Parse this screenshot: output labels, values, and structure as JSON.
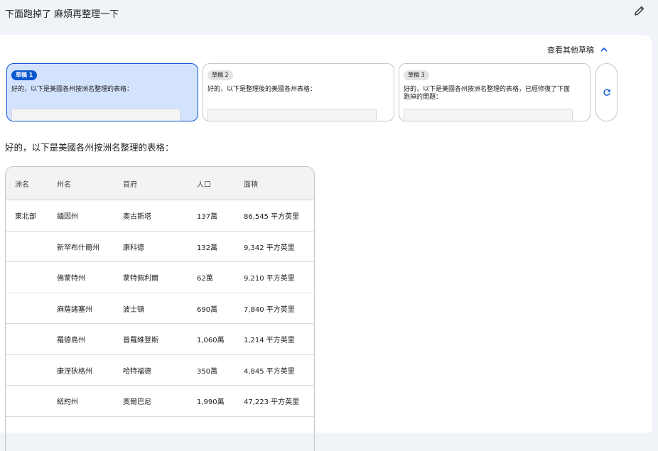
{
  "user_query": "下面跑掉了 麻煩再整理一下",
  "icons": {
    "edit": "pencil-icon",
    "speaker": "volume-icon",
    "chevron": "chevron-up-icon",
    "refresh": "refresh-icon"
  },
  "drafts_toggle_label": "查看其他草稿",
  "drafts": [
    {
      "chip": "草稿 1",
      "text": "好的，以下是美國各州按洲名整理的表格："
    },
    {
      "chip": "草稿 2",
      "text": "好的，以下是整理後的美國各州表格："
    },
    {
      "chip": "草稿 3",
      "text": "好的，以下是美國各州按洲名整理的表格，已經修復了下面跑掉的問題："
    }
  ],
  "response_intro": "好的，以下是美國各州按洲名整理的表格：",
  "table": {
    "headers": [
      "洲名",
      "州名",
      "首府",
      "人口",
      "面積"
    ],
    "rows": [
      [
        "東北部",
        "緬因州",
        "奧古斯塔",
        "137萬",
        "86,545 平方英里"
      ],
      [
        "",
        "新罕布什爾州",
        "康科德",
        "132萬",
        "9,342 平方英里"
      ],
      [
        "",
        "佛蒙特州",
        "蒙特佩利爾",
        "62萬",
        "9,210 平方英里"
      ],
      [
        "",
        "麻薩諸塞州",
        "波士頓",
        "690萬",
        "7,840 平方英里"
      ],
      [
        "",
        "羅德島州",
        "普羅維登斯",
        "1,060萬",
        "1,214 平方英里"
      ],
      [
        "",
        "康涅狄格州",
        "哈特福德",
        "350萬",
        "4,845 平方英里"
      ],
      [
        "",
        "紐約州",
        "奧爾巴尼",
        "1,990萬",
        "47,223 平方英里"
      ]
    ]
  },
  "colors": {
    "accent": "#0b57d0",
    "active_card": "#d3e3fd",
    "page_bg": "#f0f4f9"
  }
}
